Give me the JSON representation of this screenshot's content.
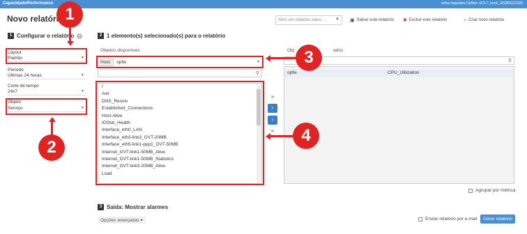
{
  "topbar": {
    "breadcrumb": "Capacidade/Performance",
    "user_info": "arthur.fagundes  OpMon v8.5.7_trunk_201801101326"
  },
  "page_title": "Novo relatório",
  "toolbar": {
    "open_report_placeholder": "Abrir um relatório salvo...",
    "save_label": "Salvar este relatório",
    "delete_label": "Excluir este relatório",
    "create_label": "Criar novo relatório"
  },
  "sections": {
    "configure": {
      "number": "1",
      "title": "Configurar o relatório"
    },
    "selected": {
      "number": "2",
      "title": "1 elemento(s) selecionado(s) para o relatório"
    },
    "output": {
      "number": "3",
      "title": "Saída: Mostrar alarmes"
    }
  },
  "config": {
    "layout_label": "Layout",
    "layout_value": "Padrão",
    "period_label": "Período",
    "period_value": "Últimas 24 horas",
    "timecut_label": "Corte de tempo",
    "timecut_value": "24x7",
    "object_label": "Objeto",
    "object_value": "Serviço"
  },
  "available": {
    "title": "Objetos disponíveis",
    "host_label": "Host:",
    "host_value": "opfw",
    "items": [
      "/",
      "/var",
      "DNS_Resolv",
      "Established_Connections",
      "Host-Alive",
      "IOStat_Health",
      "Interface_eth0_LAN",
      "Interface_eth3-link3_GVT-20MB",
      "Interface_eth5-link1-ppp1_GVT-50MB",
      "Internet_GVT-link1-50MB_Alive",
      "Internet_GVT-link1-50MB_Statistics",
      "Internet_GVT-link3-20MB_Alive",
      "Load"
    ]
  },
  "selected_panel": {
    "title_visible": "Obj",
    "title_tail": "ados",
    "rows": [
      {
        "host": "opfw",
        "service": "CPU_Utilization"
      }
    ]
  },
  "mid_buttons": {
    "add_all": "»",
    "add": "›",
    "remove": "‹",
    "remove_all": "«"
  },
  "group_by_metric_label": "Agrupar por métrica",
  "advanced_options_label": "Opções avançadas",
  "send_email_label": "Enviar relatório por e-mail",
  "generate_label": "Gerar relatório",
  "callouts": [
    "1",
    "2",
    "3",
    "4"
  ],
  "colors": {
    "topbar": "#4a8fd0",
    "annotation_red": "#e02424",
    "primary_button": "#3a7fc4"
  }
}
